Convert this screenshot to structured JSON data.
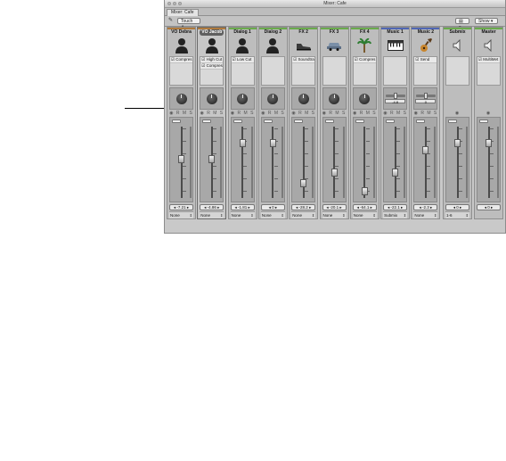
{
  "window": {
    "title": "Mixer: Cafe"
  },
  "tab": {
    "label": "Mixer: Cafe"
  },
  "toolbar": {
    "mode": "Touch",
    "show": "Show"
  },
  "colors": {
    "accent_selected": "#5f5f5f"
  },
  "strips": [
    {
      "name": "VO Debra",
      "color": "#b07a3c",
      "icon": "person-icon",
      "inserts": [
        "Compres"
      ],
      "ctrl": "knob",
      "fader_pos": 0.55,
      "value": "-7.21",
      "output": "None"
    },
    {
      "name": "VO Jacob",
      "color": "#b07a3c",
      "icon": "person-icon",
      "inserts": [
        "High Cut",
        "Compres"
      ],
      "ctrl": "knob",
      "fader_pos": 0.55,
      "value": "-4.86",
      "output": "None"
    },
    {
      "name": "Dialog 1",
      "color": "#6aab4c",
      "icon": "person-icon",
      "inserts": [
        "Low Cut"
      ],
      "ctrl": "knob",
      "fader_pos": 0.8,
      "value": "-1.81",
      "output": "None"
    },
    {
      "name": "Dialog 2",
      "color": "#6aab4c",
      "icon": "person-icon",
      "inserts": [],
      "ctrl": "knob",
      "fader_pos": 0.8,
      "value": "0",
      "output": "None"
    },
    {
      "name": "FX 2",
      "color": "#6aab4c",
      "icon": "shoe-icon",
      "inserts": [
        "Soundtra"
      ],
      "ctrl": "knob",
      "fader_pos": 0.18,
      "value": "-28.2",
      "output": "None"
    },
    {
      "name": "FX 3",
      "color": "#6aab4c",
      "icon": "car-icon",
      "inserts": [],
      "ctrl": "knob",
      "fader_pos": 0.35,
      "value": "-20.1",
      "output": "None"
    },
    {
      "name": "FX 4",
      "color": "#6aab4c",
      "icon": "palm-tree-icon",
      "inserts": [
        "Compres"
      ],
      "ctrl": "knob",
      "fader_pos": 0.05,
      "value": "-64.1",
      "output": "None"
    },
    {
      "name": "Music 1",
      "color": "#4f66b4",
      "icon": "keyboard-icon",
      "inserts": [],
      "ctrl": "slider",
      "ctrl_value": "-4.8",
      "fader_pos": 0.35,
      "value": "-22.1",
      "output": "Submix"
    },
    {
      "name": "Music 2",
      "color": "#4f66b4",
      "icon": "guitar-icon",
      "inserts": [
        "Send"
      ],
      "ctrl": "slider",
      "ctrl_value": "0",
      "fader_pos": 0.7,
      "value": "-2.3",
      "output": "None"
    },
    {
      "name": "Submix",
      "color": "#6aab4c",
      "icon": "speaker-icon",
      "inserts": [],
      "ctrl": "none",
      "fader_pos": 0.8,
      "value": "0",
      "output": "1-6"
    },
    {
      "name": "Master",
      "color": "#6aab4c",
      "icon": "speaker-icon",
      "inserts": [
        "MultiMet"
      ],
      "ctrl": "none",
      "fader_pos": 0.8,
      "value": "0",
      "output": ""
    }
  ]
}
